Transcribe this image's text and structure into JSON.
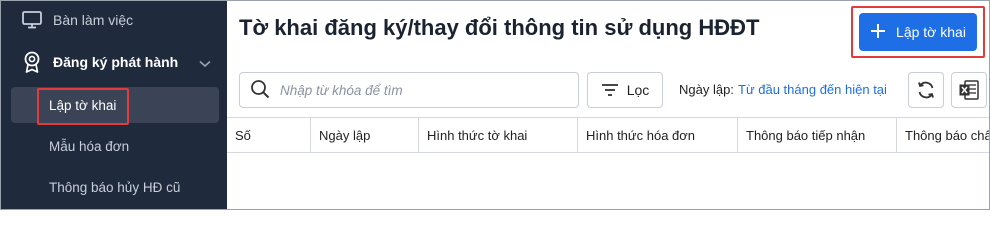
{
  "sidebar": {
    "top_item": "Bàn làm việc",
    "group": {
      "label": "Đăng ký phát hành"
    },
    "sub_items": [
      "Lập tờ khai",
      "Mẫu hóa đơn",
      "Thông báo hủy HĐ cũ"
    ]
  },
  "main": {
    "title": "Tờ khai đăng ký/thay đổi thông tin sử dụng HĐĐT",
    "add_button": "Lập tờ khai",
    "search": {
      "placeholder": "Nhập từ khóa để tìm"
    },
    "filter_button": "Lọc",
    "date": {
      "label": "Ngày lập:",
      "value": "Từ đầu tháng đến hiện tại"
    },
    "table": {
      "columns": [
        "Số",
        "Ngày lập",
        "Hình thức tờ khai",
        "Hình thức hóa đơn",
        "Thông báo tiếp nhận",
        "Thông báo chấp"
      ]
    }
  },
  "colors": {
    "sidebar_bg": "#1f2a3d",
    "accent": "#1e6fe6",
    "highlight": "#e23b3b"
  }
}
